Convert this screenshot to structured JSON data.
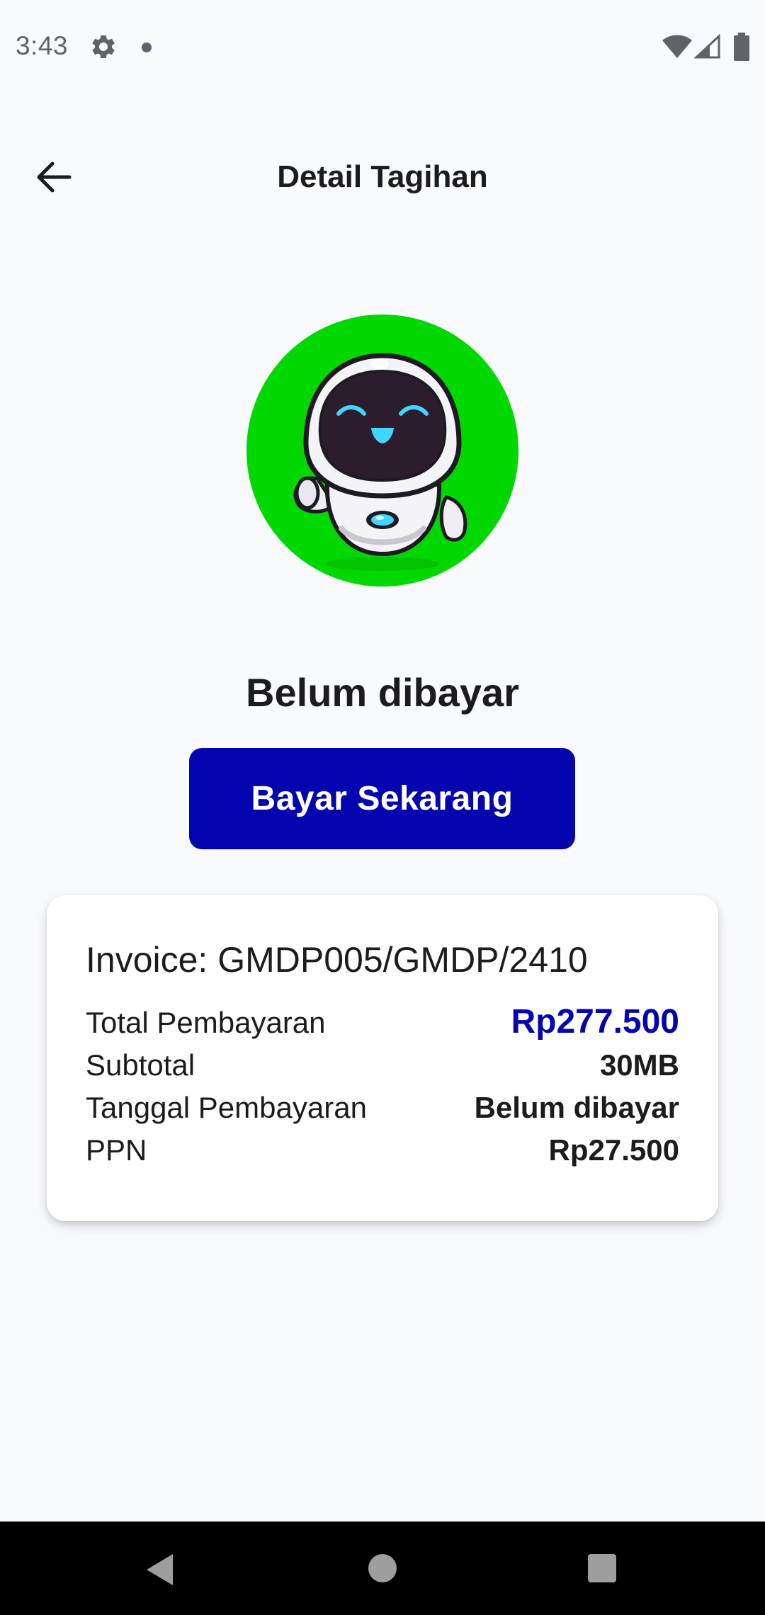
{
  "status_bar": {
    "time": "3:43",
    "icons": [
      "gear-icon",
      "notification-dot-icon",
      "wifi-icon",
      "signal-icon",
      "battery-icon"
    ]
  },
  "app_bar": {
    "title": "Detail Tagihan",
    "back_icon": "arrow-left-icon"
  },
  "avatar": {
    "icon": "robot-mascot-icon",
    "background_color": "#00d800"
  },
  "status": {
    "text": "Belum dibayar"
  },
  "pay_button": {
    "label": "Bayar Sekarang",
    "color": "#0505b0"
  },
  "invoice": {
    "number": "Invoice: GMDP005/GMDP/2410",
    "rows": [
      {
        "label": "Total Pembayaran",
        "value": "Rp277.500"
      },
      {
        "label": "Subtotal",
        "value": "30MB"
      },
      {
        "label": "Tanggal Pembayaran",
        "value": "Belum dibayar"
      },
      {
        "label": "PPN",
        "value": "Rp27.500"
      }
    ]
  },
  "nav_bar": {
    "icons": [
      "nav-back-icon",
      "nav-home-icon",
      "nav-recents-icon"
    ]
  }
}
